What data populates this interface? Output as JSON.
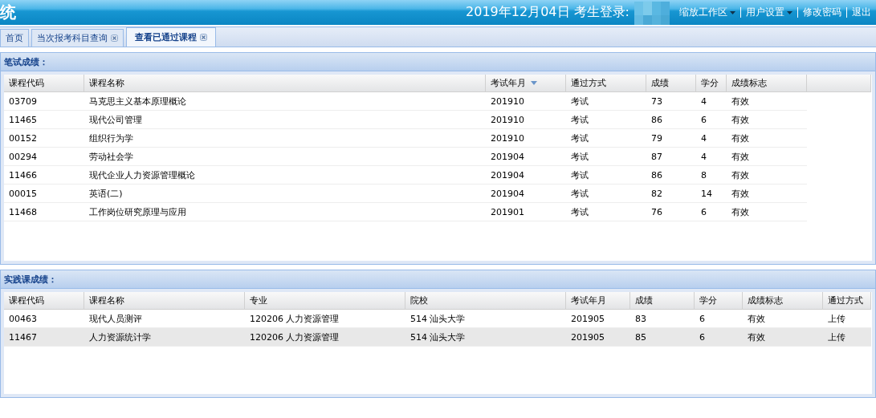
{
  "header": {
    "title": "统",
    "date": "2019年12月04日",
    "login_label": "考生登录:",
    "menu": [
      {
        "label": "缩放工作区",
        "dropdown": true
      },
      {
        "label": "用户设置",
        "dropdown": true
      },
      {
        "label": "修改密码",
        "dropdown": false
      },
      {
        "label": "退出",
        "dropdown": false
      }
    ]
  },
  "tabs": [
    {
      "label": "首页",
      "closable": false,
      "selected": false
    },
    {
      "label": "当次报考科目查询",
      "closable": true,
      "selected": false
    },
    {
      "label": "查看已通过课程",
      "closable": true,
      "selected": true
    }
  ],
  "written_scores": {
    "title": "笔试成绩：",
    "columns": [
      {
        "label": "课程代码",
        "sorted": false
      },
      {
        "label": "课程名称",
        "sorted": false
      },
      {
        "label": "考试年月",
        "sorted": true
      },
      {
        "label": "通过方式",
        "sorted": false
      },
      {
        "label": "成绩",
        "sorted": false
      },
      {
        "label": "学分",
        "sorted": false
      },
      {
        "label": "成绩标志",
        "sorted": false
      }
    ],
    "rows": [
      {
        "cells": [
          "03709",
          "马克思主义基本原理概论",
          "201910",
          "考试",
          "73",
          "4",
          "有效"
        ],
        "selected": false
      },
      {
        "cells": [
          "11465",
          "现代公司管理",
          "201910",
          "考试",
          "86",
          "6",
          "有效"
        ],
        "selected": false
      },
      {
        "cells": [
          "00152",
          "组织行为学",
          "201910",
          "考试",
          "79",
          "4",
          "有效"
        ],
        "selected": false
      },
      {
        "cells": [
          "00294",
          "劳动社会学",
          "201904",
          "考试",
          "87",
          "4",
          "有效"
        ],
        "selected": false
      },
      {
        "cells": [
          "11466",
          "现代企业人力资源管理概论",
          "201904",
          "考试",
          "86",
          "8",
          "有效"
        ],
        "selected": false
      },
      {
        "cells": [
          "00015",
          "英语(二)",
          "201904",
          "考试",
          "82",
          "14",
          "有效"
        ],
        "selected": false
      },
      {
        "cells": [
          "11468",
          "工作岗位研究原理与应用",
          "201901",
          "考试",
          "76",
          "6",
          "有效"
        ],
        "selected": false
      }
    ]
  },
  "practice_scores": {
    "title": "实践课成绩：",
    "columns": [
      {
        "label": "课程代码",
        "sorted": false
      },
      {
        "label": "课程名称",
        "sorted": false
      },
      {
        "label": "专业",
        "sorted": false
      },
      {
        "label": "院校",
        "sorted": false
      },
      {
        "label": "考试年月",
        "sorted": false
      },
      {
        "label": "成绩",
        "sorted": false
      },
      {
        "label": "学分",
        "sorted": false
      },
      {
        "label": "成绩标志",
        "sorted": false
      },
      {
        "label": "通过方式",
        "sorted": false
      }
    ],
    "rows": [
      {
        "cells": [
          "00463",
          "现代人员测评",
          "120206 人力资源管理",
          "514 汕头大学",
          "201905",
          "83",
          "6",
          "有效",
          "上传"
        ],
        "selected": false
      },
      {
        "cells": [
          "11467",
          "人力资源统计学",
          "120206 人力资源管理",
          "514 汕头大学",
          "201905",
          "85",
          "6",
          "有效",
          "上传"
        ],
        "selected": true
      }
    ]
  }
}
